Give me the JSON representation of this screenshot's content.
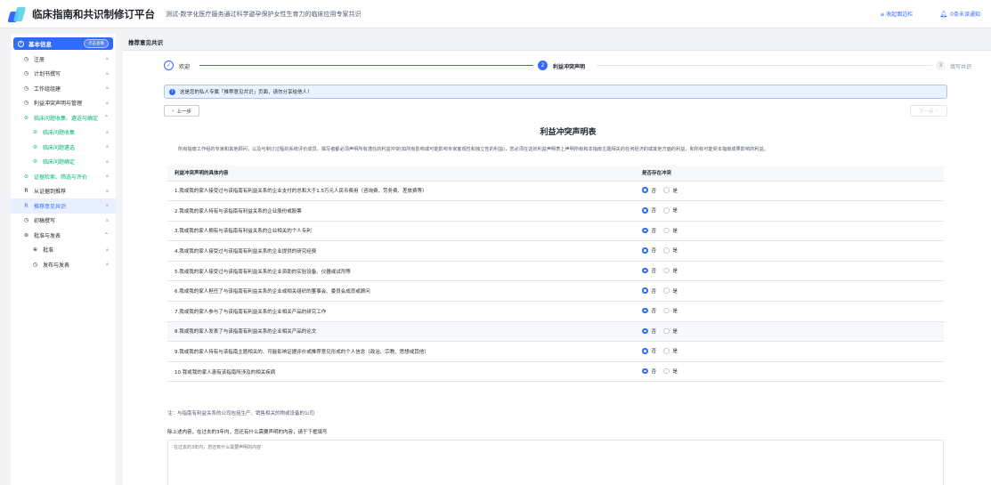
{
  "topbar": {
    "app_title": "临床指南和共识制修订平台",
    "project_title": "测试-数字化医疗服务通过科学避孕保护女性生育力的临床应用专家共识",
    "login_record": "≡ 收起面边栏",
    "notifications": "0条未读通知",
    "brand_color": "#2f6bff"
  },
  "sidebar": {
    "header": {
      "label": "基本信息",
      "badge": "点击查看"
    },
    "items": [
      {
        "label": "注册",
        "icon": "clock-icon"
      },
      {
        "label": "计划书撰写",
        "icon": "clock-icon"
      },
      {
        "label": "工作组组建",
        "icon": "clock-icon"
      },
      {
        "label": "利益冲突声明与管理",
        "icon": "clock-icon"
      },
      {
        "label": "临床问题收集、遴选与确定",
        "icon": "check-circle-icon"
      },
      {
        "label": "临床问题收集",
        "icon": "check-circle-icon"
      },
      {
        "label": "临床问题遴选",
        "icon": "check-circle-icon"
      },
      {
        "label": "临床问题确定",
        "icon": "check-circle-icon"
      },
      {
        "label": "证据检索、筛选与评价",
        "icon": "check-circle-icon"
      },
      {
        "label": "从证据到推荐",
        "icon": "r-icon"
      },
      {
        "label": "推荐意见共识",
        "icon": "r-icon"
      },
      {
        "label": "初稿撰写",
        "icon": "clock-icon"
      },
      {
        "label": "批准与发表",
        "icon": "gear-icon"
      },
      {
        "label": "批准",
        "icon": "plus-circle-icon"
      },
      {
        "label": "发布与发表",
        "icon": "clock-icon"
      }
    ]
  },
  "main": {
    "header": "推荐意见共识",
    "steps": [
      {
        "num": "✓",
        "label": "欢迎"
      },
      {
        "num": "2",
        "label": "利益冲突声明"
      },
      {
        "num": "3",
        "label": "填写共识"
      }
    ],
    "alert": "这是您的私人专属「推荐意见共识」页面，请勿分享给他人！",
    "prev_button": "上一步",
    "next_button": "下一步",
    "doc_title": "利益冲突声明表",
    "doc_desc": "所有指南工作组的专家和其他顾问，以及与制订过程的系统评价成员，撰写者都必须声明所有潜在的利益冲突(如所有影响或可能影响专家客观性和独立性的利益)，您必须在这张利益声明表上声明所有和本指南主题相关的任何经济的或其他方面的利益，和所有可能受本指南成果影响的利益。",
    "table": {
      "col1": "利益冲突声明的具体内容",
      "col2": "是否存在冲突",
      "no_label": "否",
      "yes_label": "是",
      "rows": [
        "1.我或我的家人接受过与该指南有利益关系的企业支付的总和大于1.5万元人民币费用（咨询费、劳务费、差旅费等）",
        "2.我或我的家人持有与该指南有利益关系的企业股份或股票",
        "3.我或我的家人拥有与该指南有利益关系的企业相关的个人专利",
        "4.我或我的家人接受过与该指南有利益关系的企业提供的研究经费",
        "5.我或我的家人接受过与该指南有利益关系的企业资助的实验设备、仪器或试剂等",
        "6.我或我的家人担任了与该指南有利益关系的企业或相关组织的董事会、委员会成员或顾问",
        "7.我或我的家人参与了与该指南有利益关系的企业相关产品的研究工作",
        "8.我或我的家人发表了与该指南有利益关系的企业相关产品的论文",
        "9.我或我的家人持有与该指南主题相关的、可能影响证据评价或推荐意见形成的个人信念（政治、宗教、思想或其他）",
        "10.我或我的家人患有该指南所涉及的相关疾病"
      ]
    },
    "note": "注：与指南有利益关系的公司包括生产、销售相关的物或设备的公司",
    "question": "除上述内容，在过去的3年内，您还有什么需要声明的内容，请于下框填写",
    "textarea_placeholder": "在过去的3年内，您还有什么需要声明的内容"
  }
}
